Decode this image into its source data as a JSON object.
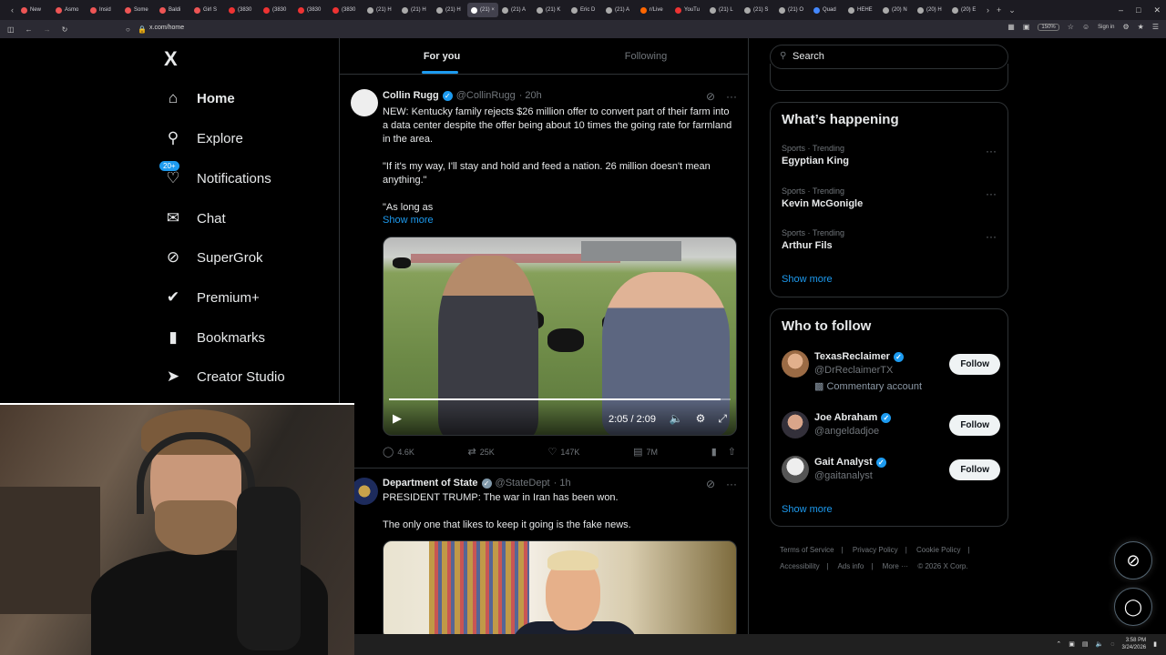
{
  "browser": {
    "tabs": [
      {
        "label": "New",
        "color": "#e55"
      },
      {
        "label": "Asmo",
        "color": "#e55"
      },
      {
        "label": "Insid",
        "color": "#e55"
      },
      {
        "label": "Some",
        "color": "#e55"
      },
      {
        "label": "Baldi",
        "color": "#e55"
      },
      {
        "label": "Girl S",
        "color": "#e55"
      },
      {
        "label": "(3830",
        "color": "#e33"
      },
      {
        "label": "(3830",
        "color": "#e33"
      },
      {
        "label": "(3830",
        "color": "#e33"
      },
      {
        "label": "(3830",
        "color": "#e33"
      },
      {
        "label": "(21) H",
        "color": "#aaa"
      },
      {
        "label": "(21) H",
        "color": "#aaa"
      },
      {
        "label": "(21) H",
        "color": "#aaa"
      },
      {
        "label": "(21) ×",
        "color": "#fff"
      },
      {
        "label": "(21) A",
        "color": "#aaa"
      },
      {
        "label": "(21) K",
        "color": "#aaa"
      },
      {
        "label": "Eric D",
        "color": "#aaa"
      },
      {
        "label": "(21) A",
        "color": "#aaa"
      },
      {
        "label": "r/Live",
        "color": "#f60"
      },
      {
        "label": "YouTu",
        "color": "#e33"
      },
      {
        "label": "(21) L",
        "color": "#aaa"
      },
      {
        "label": "(21) S",
        "color": "#aaa"
      },
      {
        "label": "(21) O",
        "color": "#aaa"
      },
      {
        "label": "Quad",
        "color": "#48f"
      },
      {
        "label": "HEHE",
        "color": "#aaa"
      },
      {
        "label": "(20) N",
        "color": "#aaa"
      },
      {
        "label": "(20) H",
        "color": "#aaa"
      },
      {
        "label": "(20) E",
        "color": "#aaa"
      }
    ],
    "url": "x.com/home",
    "zoom": "150%",
    "signin": "Sign in"
  },
  "nav": {
    "logo": "X",
    "items": [
      {
        "label": "Home",
        "icon": "home-icon"
      },
      {
        "label": "Explore",
        "icon": "search-icon"
      },
      {
        "label": "Notifications",
        "icon": "bell-icon"
      },
      {
        "label": "Chat",
        "icon": "mail-icon"
      },
      {
        "label": "SuperGrok",
        "icon": "grok-icon"
      },
      {
        "label": "Premium+",
        "icon": "premium-icon"
      },
      {
        "label": "Bookmarks",
        "icon": "bookmark-icon"
      },
      {
        "label": "Creator Studio",
        "icon": "rocket-icon"
      }
    ],
    "notif_badge": "20+"
  },
  "feed": {
    "tabs": [
      "For you",
      "Following"
    ],
    "post1": {
      "name": "Collin Rugg",
      "handle": "@CollinRugg",
      "time": "· 20h",
      "text1": "NEW: Kentucky family rejects $26 million offer to convert part of their farm into a data center despite the offer being about 10 times the going rate for farmland in the area.",
      "text2": "\"If it's my way, I'll stay and hold and feed a nation. 26 million doesn't mean anything.\"",
      "text3": "\"As long as",
      "show_more": "Show more",
      "video_time": "2:05 / 2:09",
      "video_progress": 0.97,
      "replies": "4.6K",
      "reposts": "25K",
      "likes": "147K",
      "views": "7M"
    },
    "post2": {
      "name": "Department of State",
      "handle": "@StateDept",
      "time": "· 1h",
      "text1": "PRESIDENT TRUMP: The war in Iran has been won.",
      "text2": "The only one that likes to keep it going is the fake news."
    }
  },
  "right": {
    "search_placeholder": "Search",
    "happening": {
      "title": "What’s happening",
      "trends": [
        {
          "meta": "Sports · Trending",
          "title": "Egyptian King"
        },
        {
          "meta": "Sports · Trending",
          "title": "Kevin McGonigle"
        },
        {
          "meta": "Sports · Trending",
          "title": "Arthur Fils"
        }
      ],
      "show_more": "Show more"
    },
    "who_to_follow": {
      "title": "Who to follow",
      "users": [
        {
          "name": "TexasReclaimer",
          "handle": "@DrReclaimerTX",
          "extra": "Commentary account",
          "button": "Follow"
        },
        {
          "name": "Joe Abraham",
          "handle": "@angeldadjoe",
          "button": "Follow"
        },
        {
          "name": "Gait Analyst",
          "handle": "@gaitanalyst",
          "button": "Follow"
        }
      ],
      "show_more": "Show more"
    },
    "footer": [
      "Terms of Service",
      "|",
      "Privacy Policy",
      "|",
      "Cookie Policy",
      "|",
      "Accessibility",
      "|",
      "Ads info",
      "|",
      "More ···",
      "© 2026 X Corp."
    ]
  },
  "taskbar": {
    "time": "3:58 PM",
    "date": "3/24/2026"
  }
}
